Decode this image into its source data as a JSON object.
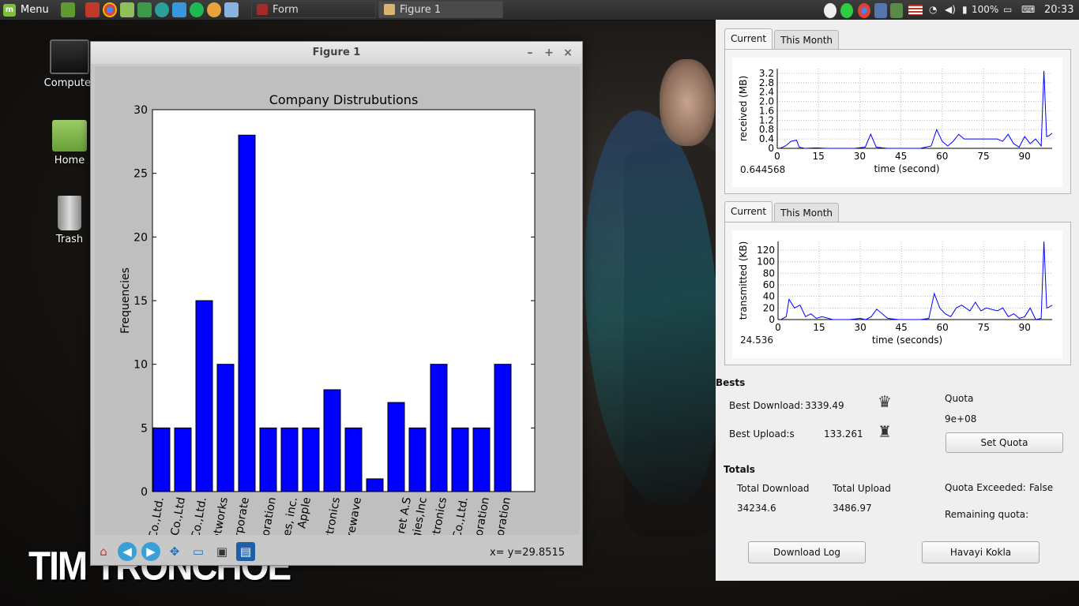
{
  "taskbar": {
    "menu_label": "Menu",
    "windows": [
      {
        "label": "Form"
      },
      {
        "label": "Figure 1"
      }
    ],
    "battery": "100%",
    "clock": "20:33"
  },
  "desktop": {
    "icons": [
      {
        "label": "Computer"
      },
      {
        "label": "Home"
      },
      {
        "label": "Trash"
      }
    ],
    "brand_text": "TIM TRONCHOE"
  },
  "figure_window": {
    "title": "Figure 1",
    "coords": "x= y=29.8515"
  },
  "chart_data": [
    {
      "type": "bar",
      "title": "Company Distrubutions",
      "xlabel": "",
      "ylabel": "Frequencies",
      "ylim": [
        0,
        30
      ],
      "yticks": [
        0,
        5,
        10,
        15,
        20,
        25,
        30
      ],
      "categories": [
        "Co.,Ltd.",
        "Co.,Ltd",
        "Co.,Ltd.",
        "etworks",
        "rporate",
        "",
        "oration",
        "es, inc.",
        "Apple",
        "ctronics",
        "rewave",
        "",
        "ret A.S",
        "gies,Inc",
        "ctronics",
        "Co.,Ltd.",
        "ooration",
        "ooration"
      ],
      "values": [
        5,
        5,
        15,
        10,
        28,
        5,
        5,
        5,
        8,
        5,
        1,
        7,
        5,
        10,
        5,
        5,
        10
      ],
      "bar_color": "#0000ff"
    },
    {
      "type": "line",
      "xlabel": "time (second)",
      "ylabel": "received (MB)",
      "xticks": [
        0,
        15,
        30,
        45,
        60,
        75,
        90
      ],
      "yticks": [
        0,
        0.4,
        0.8,
        1.2,
        1.6,
        2.0,
        2.4,
        2.8,
        3.2
      ],
      "xlim": [
        0,
        100
      ],
      "ylim": [
        0,
        3.4
      ],
      "grid": true,
      "series": [
        {
          "color": "#0000ff",
          "x": [
            1,
            3,
            5,
            7,
            8,
            10,
            14,
            18,
            22,
            28,
            32,
            34,
            36,
            40,
            46,
            52,
            56,
            58,
            60,
            62,
            64,
            66,
            68,
            72,
            76,
            80,
            82,
            84,
            86,
            88,
            90,
            92,
            94,
            96,
            97,
            98,
            99,
            100
          ],
          "y": [
            0,
            0.1,
            0.3,
            0.35,
            0.05,
            0,
            0.02,
            0,
            0,
            0,
            0.05,
            0.6,
            0.05,
            0,
            0,
            0,
            0.1,
            0.8,
            0.3,
            0.1,
            0.3,
            0.6,
            0.4,
            0.4,
            0.4,
            0.4,
            0.3,
            0.6,
            0.2,
            0.05,
            0.5,
            0.2,
            0.4,
            0.1,
            3.3,
            0.5,
            0.55,
            0.65
          ]
        }
      ]
    },
    {
      "type": "line",
      "xlabel": "time (seconds)",
      "ylabel": "transmitted (KB)",
      "xticks": [
        0,
        15,
        30,
        45,
        60,
        75,
        90
      ],
      "yticks": [
        0,
        20,
        40,
        60,
        80,
        100,
        120
      ],
      "xlim": [
        0,
        100
      ],
      "ylim": [
        0,
        135
      ],
      "grid": true,
      "series": [
        {
          "color": "#0000ff",
          "x": [
            1,
            3,
            4,
            6,
            8,
            10,
            12,
            14,
            16,
            20,
            26,
            30,
            32,
            34,
            36,
            40,
            44,
            48,
            52,
            55,
            57,
            59,
            61,
            63,
            65,
            67,
            70,
            72,
            74,
            76,
            80,
            82,
            84,
            86,
            88,
            90,
            92,
            94,
            96,
            97,
            98,
            99,
            100
          ],
          "y": [
            0,
            5,
            35,
            20,
            25,
            5,
            10,
            2,
            5,
            0,
            0,
            2,
            0,
            5,
            18,
            2,
            0,
            0,
            0,
            2,
            45,
            20,
            10,
            5,
            20,
            25,
            15,
            30,
            15,
            20,
            15,
            20,
            5,
            10,
            2,
            5,
            20,
            0,
            2,
            135,
            20,
            22,
            25
          ]
        }
      ]
    }
  ],
  "received_current": "0.644568",
  "transmitted_current": "24.536",
  "panel": {
    "tabs": [
      {
        "label": "Current"
      },
      {
        "label": "This Month"
      }
    ],
    "bests_heading": "Bests",
    "best_download_label": "Best Download:",
    "best_download_value": "3339.49",
    "best_upload_label": "Best Upload:s",
    "best_upload_value": "133.261",
    "quota_label": "Quota",
    "quota_value": "9e+08",
    "set_quota_button": "Set Quota",
    "totals_heading": "Totals",
    "total_download_label": "Total Download",
    "total_download_value": "34234.6",
    "total_upload_label": "Total Upload",
    "total_upload_value": "3486.97",
    "quota_exceeded_label": "Quota Exceeded:",
    "quota_exceeded_value": "False",
    "remaining_quota_label": "Remaining quota:",
    "download_log_button": "Download Log",
    "havayi_button": "Havayi Kokla"
  }
}
